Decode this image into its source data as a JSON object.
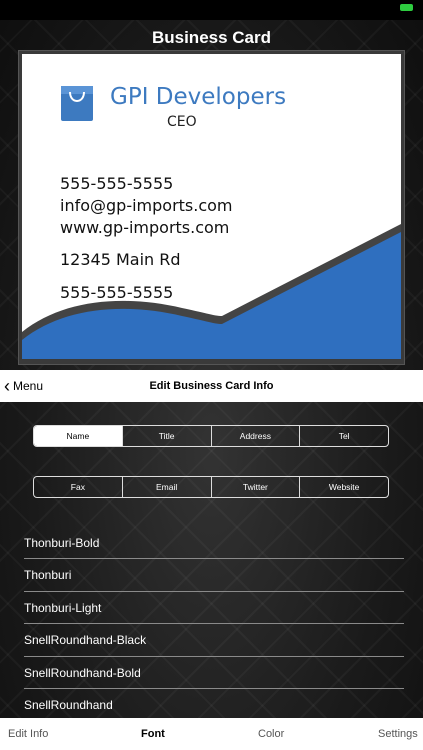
{
  "title": "Business Card",
  "card": {
    "company": "GPI Developers",
    "job_title": "CEO",
    "lines": [
      "555-555-5555",
      "info@gp-imports.com",
      "www.gp-imports.com",
      "12345 Main Rd",
      "555-555-5555"
    ],
    "accent_color": "#2f6fbf"
  },
  "navbar": {
    "back_label": "Menu",
    "title": "Edit Business Card Info"
  },
  "fields_row1": [
    {
      "label": "Name",
      "selected": true
    },
    {
      "label": "Title",
      "selected": false
    },
    {
      "label": "Address",
      "selected": false
    },
    {
      "label": "Tel",
      "selected": false
    }
  ],
  "fields_row2": [
    {
      "label": "Fax",
      "selected": false
    },
    {
      "label": "Email",
      "selected": false
    },
    {
      "label": "Twitter",
      "selected": false
    },
    {
      "label": "Website",
      "selected": false
    }
  ],
  "fonts": [
    "Thonburi-Bold",
    "Thonburi",
    "Thonburi-Light",
    "SnellRoundhand-Black",
    "SnellRoundhand-Bold",
    "SnellRoundhand"
  ],
  "tabs": [
    {
      "label": "Edit Info",
      "active": false
    },
    {
      "label": "Font",
      "active": true
    },
    {
      "label": "Color",
      "active": false
    },
    {
      "label": "Settings",
      "active": false
    }
  ]
}
